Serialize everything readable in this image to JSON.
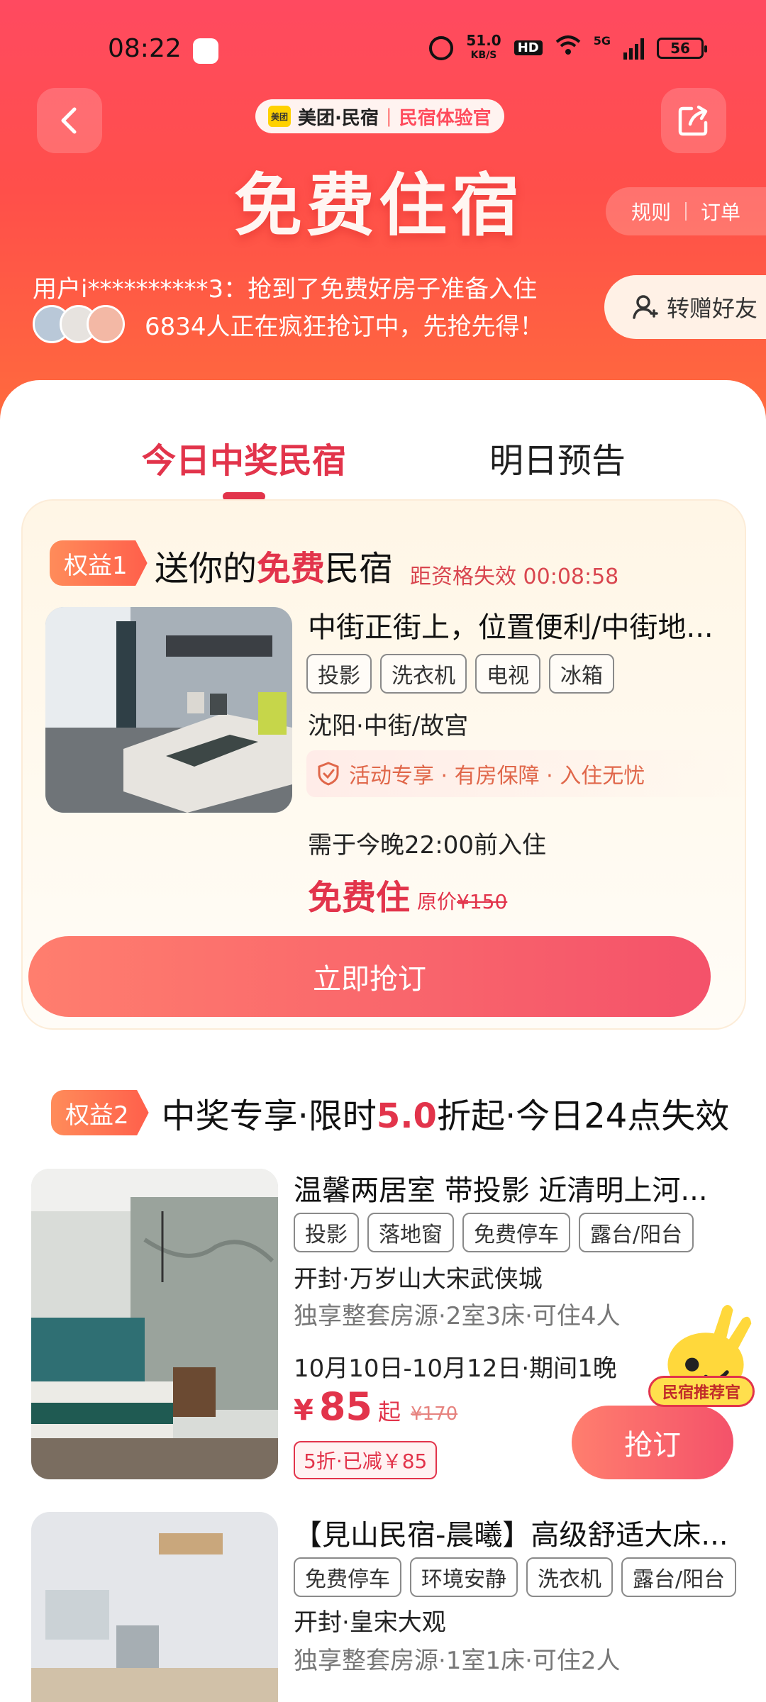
{
  "status_bar": {
    "time": "08:22",
    "net_speed": "51.0",
    "net_unit": "KB/S",
    "hd": "HD",
    "network": "5G",
    "battery": "56"
  },
  "header": {
    "brand_name": "美团·民宿",
    "brand_tag": "民宿体验官",
    "title": "免费住宿",
    "rules_label": "规则",
    "orders_label": "订单",
    "ticker": "用户i**********3：抢到了免费好房子准备入住",
    "crowd_text": "6834人正在疯狂抢订中，先抢先得！",
    "gift_label": "转赠好友"
  },
  "tabs": {
    "today": "今日中奖民宿",
    "tomorrow": "明日预告"
  },
  "benefit1": {
    "badge": "权益1",
    "title_prefix": "送你的",
    "title_highlight": "免费",
    "title_suffix": "民宿",
    "countdown": "距资格失效 00:08:58",
    "name": "中街正街上，位置便利/中街地...",
    "tags": [
      "投影",
      "洗衣机",
      "电视",
      "冰箱"
    ],
    "location": "沈阳·中街/故宫",
    "guarantee": "活动专享 · 有房保障 · 入住无忧",
    "checkin": "需于今晚22:00前入住",
    "free_label": "免费住",
    "orig_prefix": "原价",
    "orig_price": "¥150",
    "button": "立即抢订"
  },
  "benefit2": {
    "badge": "权益2",
    "title_prefix": "中奖专享·限时",
    "title_highlight": "5.0",
    "title_suffix": "折起·今日24点失效",
    "listings": [
      {
        "name": "温馨两居室 带投影 近清明上河...",
        "tags": [
          "投影",
          "落地窗",
          "免费停车",
          "露台/阳台"
        ],
        "location": "开封·万岁山大宋武侠城",
        "rooms": "独享整套房源·2室3床·可住4人",
        "dates": "10月10日-10月12日·期间1晚",
        "currency": "¥",
        "price": "85",
        "price_suffix": "起",
        "orig_price": "¥170",
        "discount": "5折·已减￥85",
        "button": "抢订"
      },
      {
        "name": "【見山民宿-晨曦】高级舒适大床...",
        "tags": [
          "免费停车",
          "环境安静",
          "洗衣机",
          "露台/阳台"
        ],
        "location": "开封·皇宋大观",
        "rooms": "独享整套房源·1室1床·可住2人"
      }
    ]
  },
  "mascot": {
    "label": "民宿推荐官"
  },
  "colors": {
    "accent": "#e2344b",
    "header_top": "#ff4a60",
    "header_bottom": "#ff6b3d",
    "card_bg": "#fff6e6"
  }
}
